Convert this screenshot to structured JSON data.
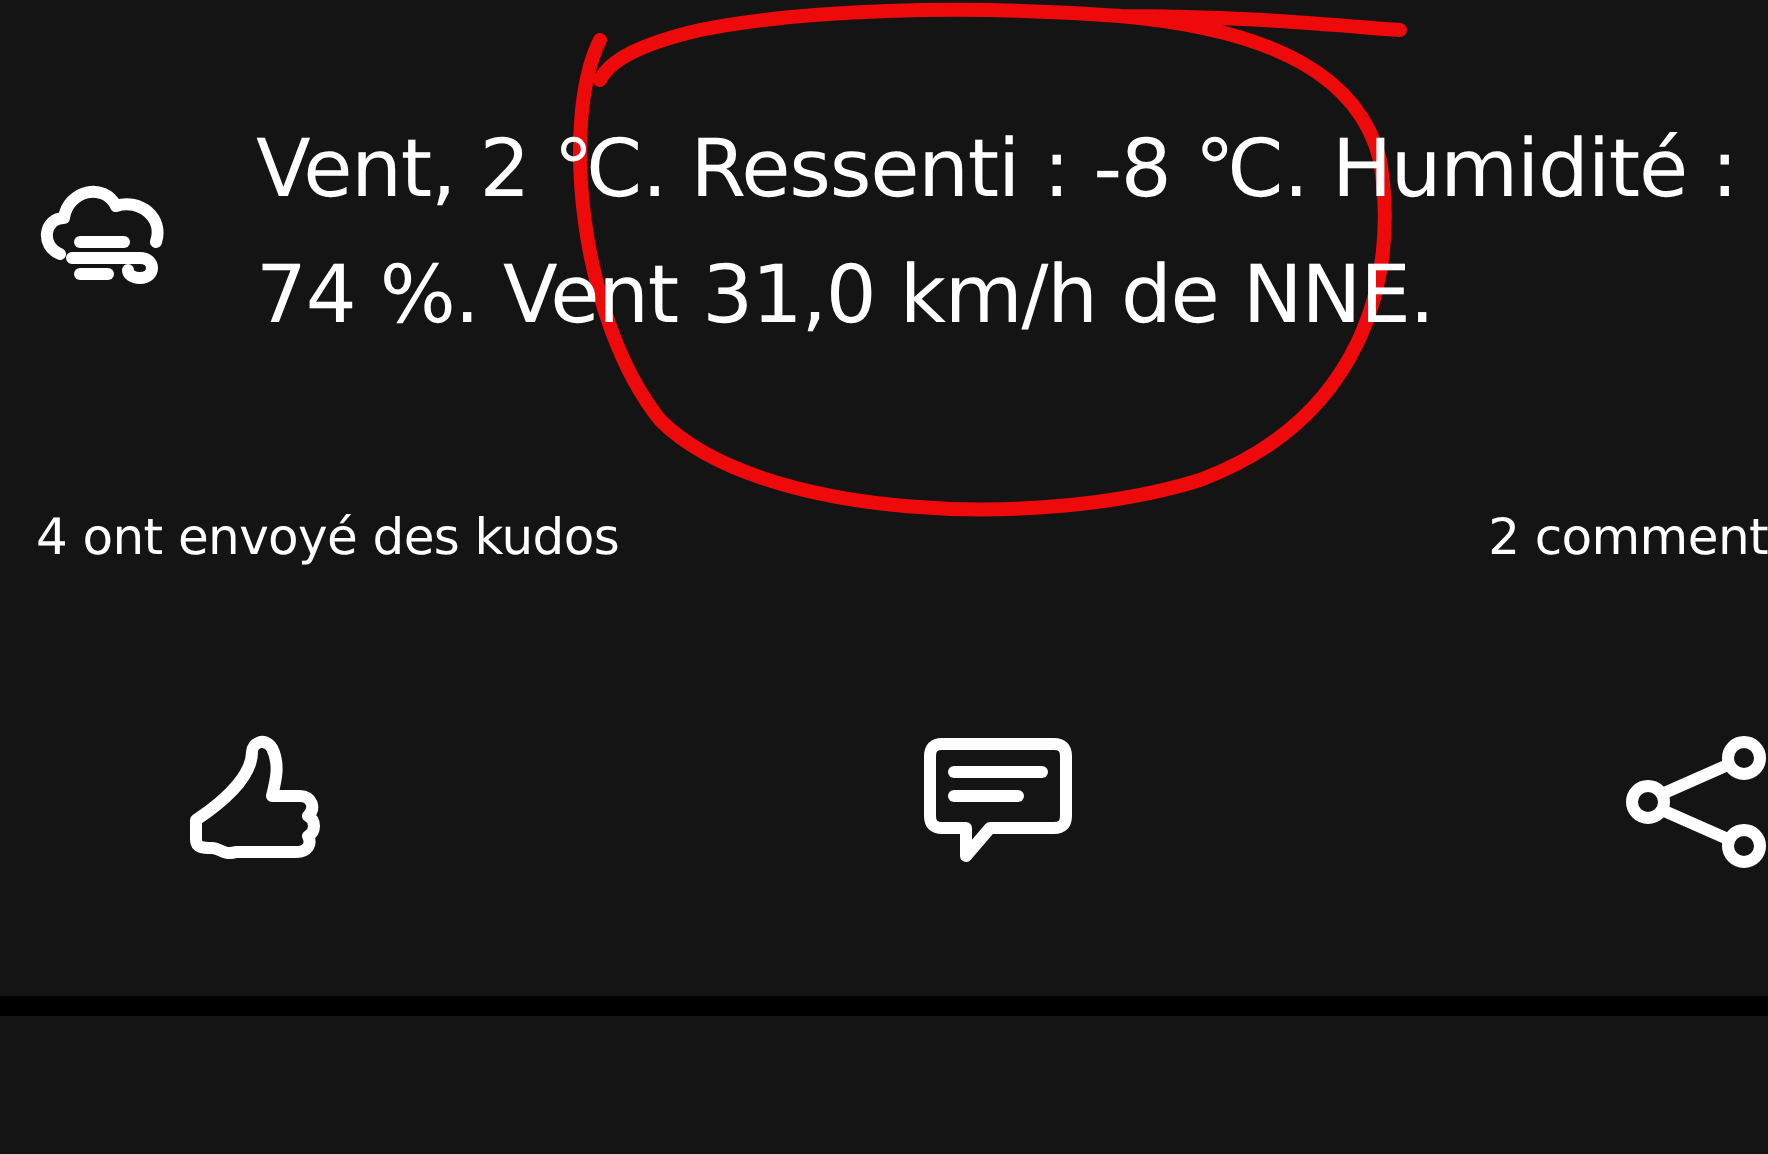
{
  "activity": {
    "weather_text": "Vent, 2 ℃. Ressenti : -8 ℃. Humidité : 74 %. Vent 31,0 km/h de NNE.",
    "kudos": "4 ont envoyé des kudos",
    "comments": "2 comment"
  },
  "actions": [
    {
      "kind": "kudos"
    },
    {
      "kind": "comment"
    },
    {
      "kind": "share"
    }
  ]
}
